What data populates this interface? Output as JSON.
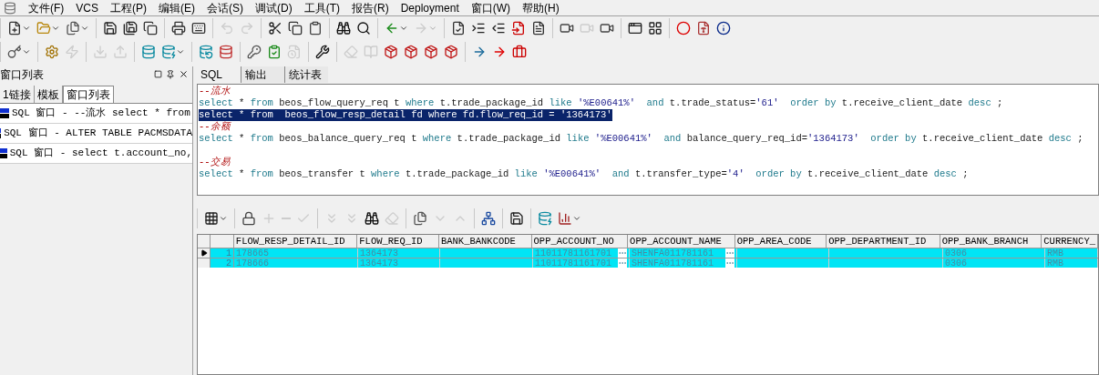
{
  "menu": [
    "文件(F)",
    "VCS",
    "工程(P)",
    "编辑(E)",
    "会话(S)",
    "调试(D)",
    "工具(T)",
    "报告(R)",
    "Deployment",
    "窗口(W)",
    "帮助(H)"
  ],
  "toolbar_rows": [
    [
      [
        {
          "kind": "new",
          "disabled": false,
          "dropdown": true
        },
        {
          "kind": "open",
          "disabled": false,
          "dropdown": true
        },
        {
          "kind": "files",
          "disabled": false,
          "dropdown": true
        }
      ],
      [
        {
          "kind": "save",
          "disabled": false
        },
        {
          "kind": "saveall",
          "disabled": false
        },
        {
          "kind": "copy",
          "disabled": false
        }
      ],
      [
        {
          "kind": "print",
          "disabled": false
        },
        {
          "kind": "keyboard",
          "disabled": false
        }
      ],
      [
        {
          "kind": "undo",
          "disabled": true
        },
        {
          "kind": "redo",
          "disabled": true
        }
      ],
      [
        {
          "kind": "cut",
          "disabled": false
        },
        {
          "kind": "copy",
          "disabled": false
        },
        {
          "kind": "paste",
          "disabled": false
        }
      ],
      [
        {
          "kind": "find",
          "disabled": false
        },
        {
          "kind": "findnext",
          "disabled": false
        }
      ],
      [
        {
          "kind": "back",
          "disabled": false,
          "dropdown": true
        },
        {
          "kind": "forward",
          "disabled": true,
          "dropdown": true
        }
      ],
      [
        {
          "kind": "filecheck",
          "disabled": false
        },
        {
          "kind": "indent",
          "disabled": false
        },
        {
          "kind": "outdent",
          "disabled": false
        },
        {
          "kind": "filein",
          "disabled": false
        },
        {
          "kind": "doc",
          "disabled": false
        }
      ],
      [
        {
          "kind": "camera",
          "disabled": false
        },
        {
          "kind": "camera",
          "disabled": true
        },
        {
          "kind": "camera",
          "disabled": false
        }
      ],
      [
        {
          "kind": "windows",
          "disabled": false
        },
        {
          "kind": "tile",
          "disabled": false
        }
      ],
      [
        {
          "kind": "oracle",
          "disabled": false
        },
        {
          "kind": "pdf",
          "disabled": false
        },
        {
          "kind": "info",
          "disabled": false
        }
      ]
    ],
    [
      [
        {
          "kind": "key",
          "disabled": false,
          "dropdown": true
        }
      ],
      [
        {
          "kind": "gear",
          "disabled": false
        },
        {
          "kind": "bolt",
          "disabled": true
        }
      ],
      [
        {
          "kind": "import",
          "disabled": true
        },
        {
          "kind": "export",
          "disabled": true
        }
      ],
      [
        {
          "kind": "dbidea",
          "disabled": false
        },
        {
          "kind": "dbsql",
          "disabled": false,
          "dropdown": true
        }
      ],
      [
        {
          "kind": "dbfind",
          "disabled": false
        },
        {
          "kind": "dbclose",
          "disabled": false
        }
      ],
      [
        {
          "kind": "keys",
          "disabled": false
        },
        {
          "kind": "checklist",
          "disabled": false
        },
        {
          "kind": "docclock",
          "disabled": true
        }
      ],
      [
        {
          "kind": "wrench",
          "disabled": false
        }
      ],
      [
        {
          "kind": "eraser",
          "disabled": true
        },
        {
          "kind": "book",
          "disabled": true
        },
        {
          "kind": "package",
          "disabled": false
        },
        {
          "kind": "package",
          "disabled": false
        },
        {
          "kind": "package",
          "disabled": false
        },
        {
          "kind": "package",
          "disabled": false
        }
      ],
      [
        {
          "kind": "right",
          "disabled": false
        },
        {
          "kind": "redright",
          "disabled": false
        },
        {
          "kind": "toolbox",
          "disabled": false
        }
      ]
    ]
  ],
  "side_panel": {
    "title": "窗口列表",
    "tabs": [
      {
        "label": "1链接",
        "selected": false
      },
      {
        "label": "模板",
        "selected": false
      },
      {
        "label": "窗口列表",
        "selected": true
      }
    ],
    "items": [
      "SQL 窗口 - --流水 select * from",
      "SQL 窗口 - ALTER TABLE PACMSDATA",
      "SQL 窗口 - select t.account_no,"
    ]
  },
  "editor_tabs": [
    {
      "label": "SQL",
      "selected": true
    },
    {
      "label": "输出",
      "selected": false
    },
    {
      "label": "统计表",
      "selected": false
    }
  ],
  "editor_lines": [
    {
      "kind": "comment",
      "text": "--流水"
    },
    {
      "kind": "code",
      "selected": false,
      "tokens": [
        {
          "kind": "kw",
          "text": "select"
        },
        {
          "kind": "p",
          "text": " * "
        },
        {
          "kind": "kw",
          "text": "from"
        },
        {
          "kind": "p",
          "text": " beos_flow_query_req t "
        },
        {
          "kind": "kw",
          "text": "where"
        },
        {
          "kind": "p",
          "text": " t.trade_package_id "
        },
        {
          "kind": "kw",
          "text": "like"
        },
        {
          "kind": "str",
          "text": " '%E00641%' "
        },
        {
          "kind": "kw",
          "text": " and"
        },
        {
          "kind": "p",
          "text": " t.trade_status="
        },
        {
          "kind": "str",
          "text": "'61' "
        },
        {
          "kind": "kw",
          "text": " order by"
        },
        {
          "kind": "p",
          "text": " t.receive_client_date "
        },
        {
          "kind": "kw",
          "text": "desc"
        },
        {
          "kind": "p",
          "text": " ;"
        }
      ]
    },
    {
      "kind": "code",
      "selected": true,
      "text": "select * from  beos_flow_resp_detail fd where fd.flow_req_id = '1364173'"
    },
    {
      "kind": "comment",
      "text": "--余额"
    },
    {
      "kind": "code",
      "selected": false,
      "tokens": [
        {
          "kind": "kw",
          "text": "select"
        },
        {
          "kind": "p",
          "text": " * "
        },
        {
          "kind": "kw",
          "text": "from"
        },
        {
          "kind": "p",
          "text": " beos_balance_query_req t "
        },
        {
          "kind": "kw",
          "text": "where"
        },
        {
          "kind": "p",
          "text": " t.trade_package_id "
        },
        {
          "kind": "kw",
          "text": "like"
        },
        {
          "kind": "str",
          "text": " '%E00641%' "
        },
        {
          "kind": "kw",
          "text": " and"
        },
        {
          "kind": "p",
          "text": " balance_query_req_id="
        },
        {
          "kind": "str",
          "text": "'1364173' "
        },
        {
          "kind": "kw",
          "text": " order by"
        },
        {
          "kind": "p",
          "text": " t.receive_client_date "
        },
        {
          "kind": "kw",
          "text": "desc"
        },
        {
          "kind": "p",
          "text": " ;"
        }
      ]
    },
    {
      "kind": "blank"
    },
    {
      "kind": "comment",
      "text": "--交易"
    },
    {
      "kind": "code",
      "selected": false,
      "tokens": [
        {
          "kind": "kw",
          "text": "select"
        },
        {
          "kind": "p",
          "text": " * "
        },
        {
          "kind": "kw",
          "text": "from"
        },
        {
          "kind": "p",
          "text": " beos_transfer t "
        },
        {
          "kind": "kw",
          "text": "where"
        },
        {
          "kind": "p",
          "text": " t.trade_package_id "
        },
        {
          "kind": "kw",
          "text": "like"
        },
        {
          "kind": "str",
          "text": " '%E00641%' "
        },
        {
          "kind": "kw",
          "text": " and"
        },
        {
          "kind": "p",
          "text": " t.transfer_type="
        },
        {
          "kind": "str",
          "text": "'4' "
        },
        {
          "kind": "kw",
          "text": " order by"
        },
        {
          "kind": "p",
          "text": " t.receive_client_date "
        },
        {
          "kind": "kw",
          "text": "desc"
        },
        {
          "kind": "p",
          "text": " ;"
        }
      ]
    }
  ],
  "grid_toolbar": [
    [
      {
        "kind": "grid",
        "disabled": false,
        "dropdown": true
      }
    ],
    [
      {
        "kind": "lock",
        "disabled": false
      },
      {
        "kind": "plus",
        "disabled": true
      },
      {
        "kind": "minus",
        "disabled": true
      },
      {
        "kind": "check",
        "disabled": true
      }
    ],
    [
      {
        "kind": "down2",
        "disabled": true
      },
      {
        "kind": "down2",
        "disabled": true
      },
      {
        "kind": "find",
        "disabled": false
      },
      {
        "kind": "eraser",
        "disabled": true
      }
    ],
    [
      {
        "kind": "files",
        "disabled": false
      },
      {
        "kind": "chevdown",
        "disabled": true
      },
      {
        "kind": "chevup",
        "disabled": true
      }
    ],
    [
      {
        "kind": "tree",
        "disabled": false
      }
    ],
    [
      {
        "kind": "save",
        "disabled": false
      }
    ],
    [
      {
        "kind": "dbsql",
        "disabled": false
      },
      {
        "kind": "chart",
        "disabled": false,
        "dropdown": true
      }
    ]
  ],
  "table": {
    "columns": [
      {
        "label": "FLOW_RESP_DETAIL_ID",
        "kind": "plain"
      },
      {
        "label": "FLOW_REQ_ID",
        "kind": "plain"
      },
      {
        "label": "BANK_BANKCODE",
        "kind": "plain"
      },
      {
        "label": "OPP_ACCOUNT_NO",
        "kind": "lookup"
      },
      {
        "label": "OPP_ACCOUNT_NAME",
        "kind": "lookup"
      },
      {
        "label": "OPP_AREA_CODE",
        "kind": "plain"
      },
      {
        "label": "OPP_DEPARTMENT_ID",
        "kind": "plain"
      },
      {
        "label": "OPP_BANK_BRANCH",
        "kind": "plain"
      },
      {
        "label": "CURRENCY_",
        "kind": "plain"
      }
    ],
    "rows": [
      {
        "number": "1",
        "current": true,
        "selected": true,
        "cells": [
          "178665",
          "1364173",
          "",
          "11011781161701",
          "SHENFA011781161",
          "",
          "",
          "0306",
          "RMB"
        ]
      },
      {
        "number": "2",
        "current": false,
        "selected": true,
        "cells": [
          "178666",
          "1364173",
          "",
          "11011781161701",
          "SHENFA011781161",
          "",
          "",
          "0306",
          "RMB"
        ]
      }
    ]
  }
}
